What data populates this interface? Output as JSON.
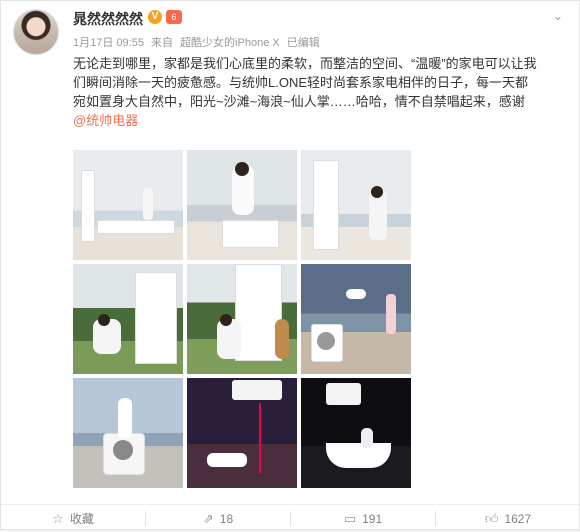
{
  "post": {
    "author": "晁然然然然",
    "verified_badge": "V",
    "level_badge": "6",
    "date": "1月17日 09:55",
    "source_prefix": "来自",
    "source": "超酷少女的iPhone X",
    "edited": "已编辑",
    "text_lines": [
      "无论走到哪里，家都是我们心底里的柔软，而整洁的空间、“温暖”的家电可以让我",
      "们瞬间消除一天的疲惫感。与统帅L.ONE轻时尚套系家电相伴的日子，每一天都",
      "宛如置身大自然中，阳光~沙滩~海浪~仙人掌……哈哈，情不自禁唱起来，感谢"
    ],
    "mention": "@统帅电器",
    "icons": {
      "menu": "chevron-down-icon",
      "favorite": "favorite-icon",
      "repost": "repost-icon",
      "comment": "comment-icon",
      "like": "thumbs-up-icon"
    }
  },
  "footer": {
    "favorite_label": "收藏",
    "repost_count": "18",
    "comment_count": "191",
    "like_count": "1627"
  },
  "colors": {
    "accent": "#eb7350",
    "verified": "#f7a21b",
    "text": "#333333",
    "meta": "#999999"
  }
}
